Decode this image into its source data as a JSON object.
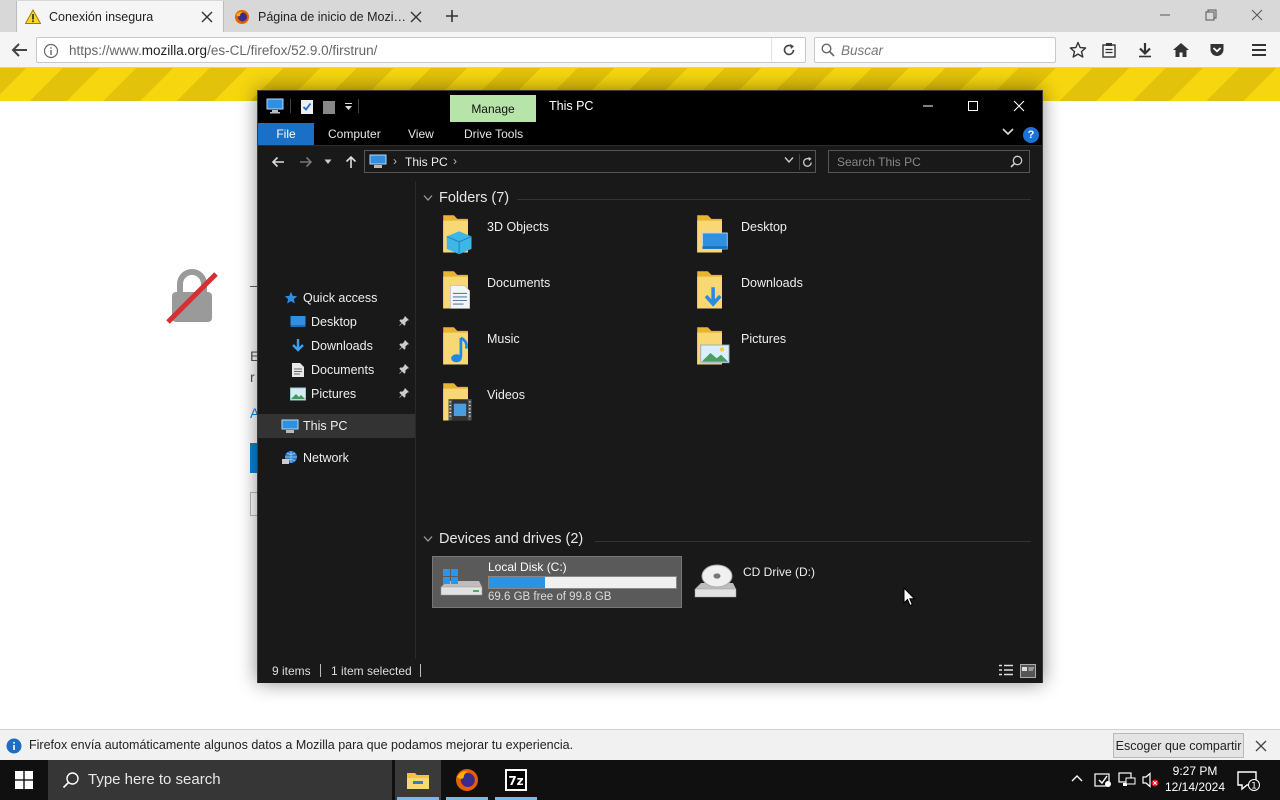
{
  "browser": {
    "tabs": [
      {
        "label": "Conexión insegura",
        "active": true
      },
      {
        "label": "Página de inicio de Mozill...",
        "active": false
      }
    ],
    "url_prefix": "https://www.",
    "url_domain": "mozilla.org",
    "url_path": "/es-CL/firefox/52.9.0/firstrun/",
    "search_placeholder": "Buscar"
  },
  "page": {
    "frag_1": "E",
    "frag_2": "r",
    "frag_3": "A",
    "frag_4": "–"
  },
  "explorer": {
    "manage_label": "Manage",
    "window_title": "This PC",
    "ribbon_tabs": [
      "File",
      "Computer",
      "View",
      "Drive Tools"
    ],
    "help_label": "?",
    "breadcrumb": "This PC",
    "search_placeholder": "Search This PC",
    "nav": {
      "quick_access": "Quick access",
      "pinned": [
        "Desktop",
        "Downloads",
        "Documents",
        "Pictures"
      ],
      "this_pc": "This PC",
      "network": "Network"
    },
    "folders_header": "Folders (7)",
    "folders": [
      {
        "name": "3D Objects",
        "icon": "3d-objects-folder-icon"
      },
      {
        "name": "Desktop",
        "icon": "desktop-folder-icon"
      },
      {
        "name": "Documents",
        "icon": "documents-folder-icon"
      },
      {
        "name": "Downloads",
        "icon": "downloads-folder-icon"
      },
      {
        "name": "Music",
        "icon": "music-folder-icon"
      },
      {
        "name": "Pictures",
        "icon": "pictures-folder-icon"
      },
      {
        "name": "Videos",
        "icon": "videos-folder-icon"
      }
    ],
    "devices_header": "Devices and drives (2)",
    "drives": [
      {
        "name": "Local Disk (C:)",
        "free_text": "69.6 GB free of 99.8 GB",
        "used_fraction": 0.3,
        "selected": true
      },
      {
        "name": "CD Drive (D:)",
        "selected": false
      }
    ],
    "status": {
      "items": "9 items",
      "selected": "1 item selected"
    }
  },
  "notification": {
    "text": "Firefox envía automáticamente algunos datos a Mozilla para que podamos mejorar tu experiencia.",
    "button": "Escoger que compartir"
  },
  "taskbar": {
    "search_placeholder": "Type here to search",
    "time": "9:27 PM",
    "date": "12/14/2024",
    "notifications_count": "1"
  },
  "colors": {
    "accent": "#1a6fc6",
    "manage_tab": "#b7e4a8",
    "warning_stripe": "#f5d60f",
    "drive_bar": "#2d92df"
  }
}
